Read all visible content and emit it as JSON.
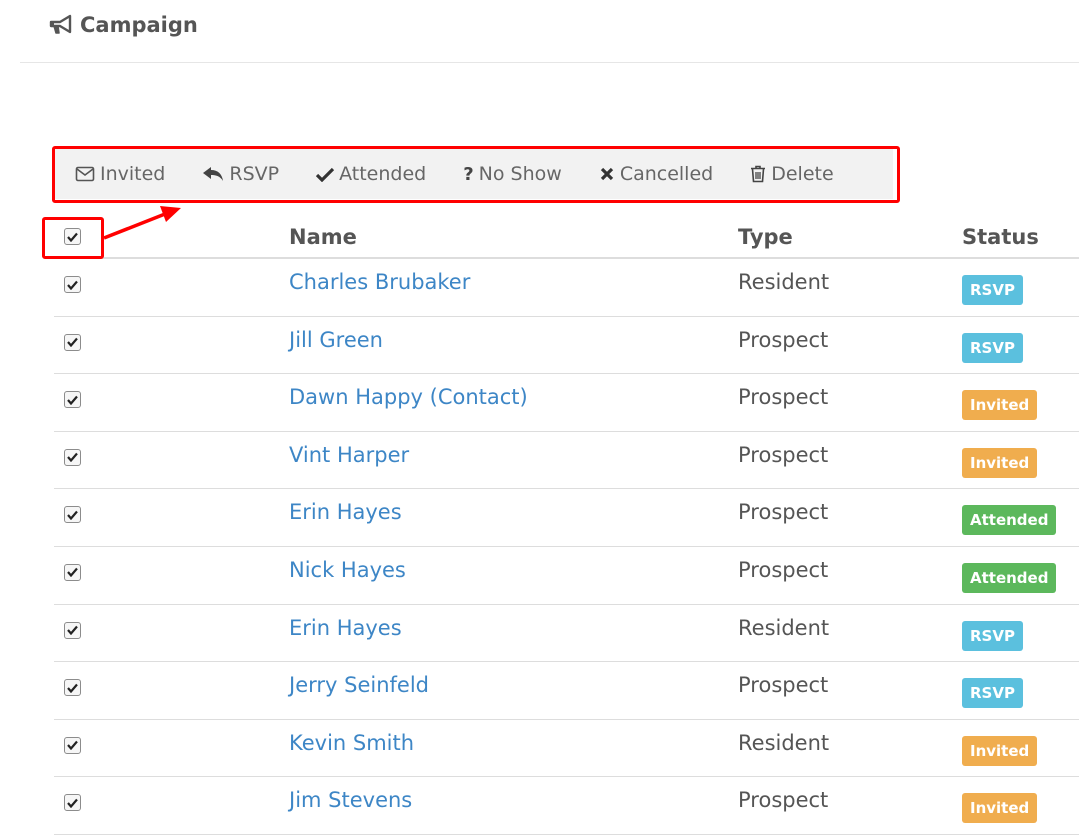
{
  "header": {
    "title": "Campaign",
    "icon": "bullhorn-icon"
  },
  "toolbar": {
    "buttons": [
      {
        "label": "Invited",
        "icon": "envelope-icon"
      },
      {
        "label": "RSVP",
        "icon": "reply-icon"
      },
      {
        "label": "Attended",
        "icon": "check-icon"
      },
      {
        "label": "No Show",
        "icon": "question-icon"
      },
      {
        "label": "Cancelled",
        "icon": "times-icon"
      },
      {
        "label": "Delete",
        "icon": "trash-icon"
      }
    ]
  },
  "table": {
    "headers": {
      "name": "Name",
      "type": "Type",
      "status": "Status"
    },
    "select_all_checked": true,
    "rows": [
      {
        "name": "Charles Brubaker",
        "type": "Resident",
        "status": "RSVP",
        "checked": true
      },
      {
        "name": "Jill Green",
        "type": "Prospect",
        "status": "RSVP",
        "checked": true
      },
      {
        "name": "Dawn Happy (Contact)",
        "type": "Prospect",
        "status": "Invited",
        "checked": true
      },
      {
        "name": "Vint Harper",
        "type": "Prospect",
        "status": "Invited",
        "checked": true
      },
      {
        "name": "Erin Hayes",
        "type": "Prospect",
        "status": "Attended",
        "checked": true
      },
      {
        "name": "Nick Hayes",
        "type": "Prospect",
        "status": "Attended",
        "checked": true
      },
      {
        "name": "Erin Hayes",
        "type": "Resident",
        "status": "RSVP",
        "checked": true
      },
      {
        "name": "Jerry Seinfeld",
        "type": "Prospect",
        "status": "RSVP",
        "checked": true
      },
      {
        "name": "Kevin Smith",
        "type": "Resident",
        "status": "Invited",
        "checked": true
      },
      {
        "name": "Jim Stevens",
        "type": "Prospect",
        "status": "Invited",
        "checked": true
      }
    ]
  },
  "colors": {
    "link": "#3d86c6",
    "rsvp": "#5bc0de",
    "invited": "#f0ad4e",
    "attended": "#5cb85c",
    "highlight": "#ff0000"
  }
}
